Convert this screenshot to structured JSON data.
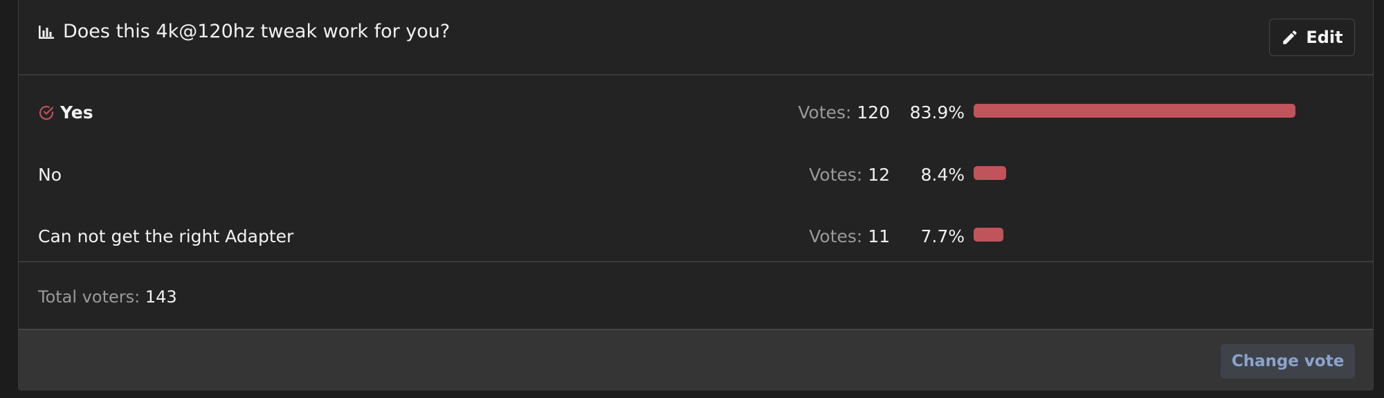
{
  "poll": {
    "title": "Does this 4k@120hz tweak work for you?",
    "title_icon": "bar-chart-icon",
    "edit_label": "Edit",
    "edit_icon": "pencil-icon",
    "accent_color": "#c0545a",
    "options": [
      {
        "label": "Yes",
        "selected": true,
        "votes_label": "Votes:",
        "votes": "120",
        "percent": "83.9%",
        "fraction": 0.839
      },
      {
        "label": "No",
        "selected": false,
        "votes_label": "Votes:",
        "votes": "12",
        "percent": "8.4%",
        "fraction": 0.084
      },
      {
        "label": "Can not get the right Adapter",
        "selected": false,
        "votes_label": "Votes:",
        "votes": "11",
        "percent": "7.7%",
        "fraction": 0.077
      }
    ],
    "total_label": "Total voters:",
    "total_value": "143",
    "change_vote_label": "Change vote"
  }
}
